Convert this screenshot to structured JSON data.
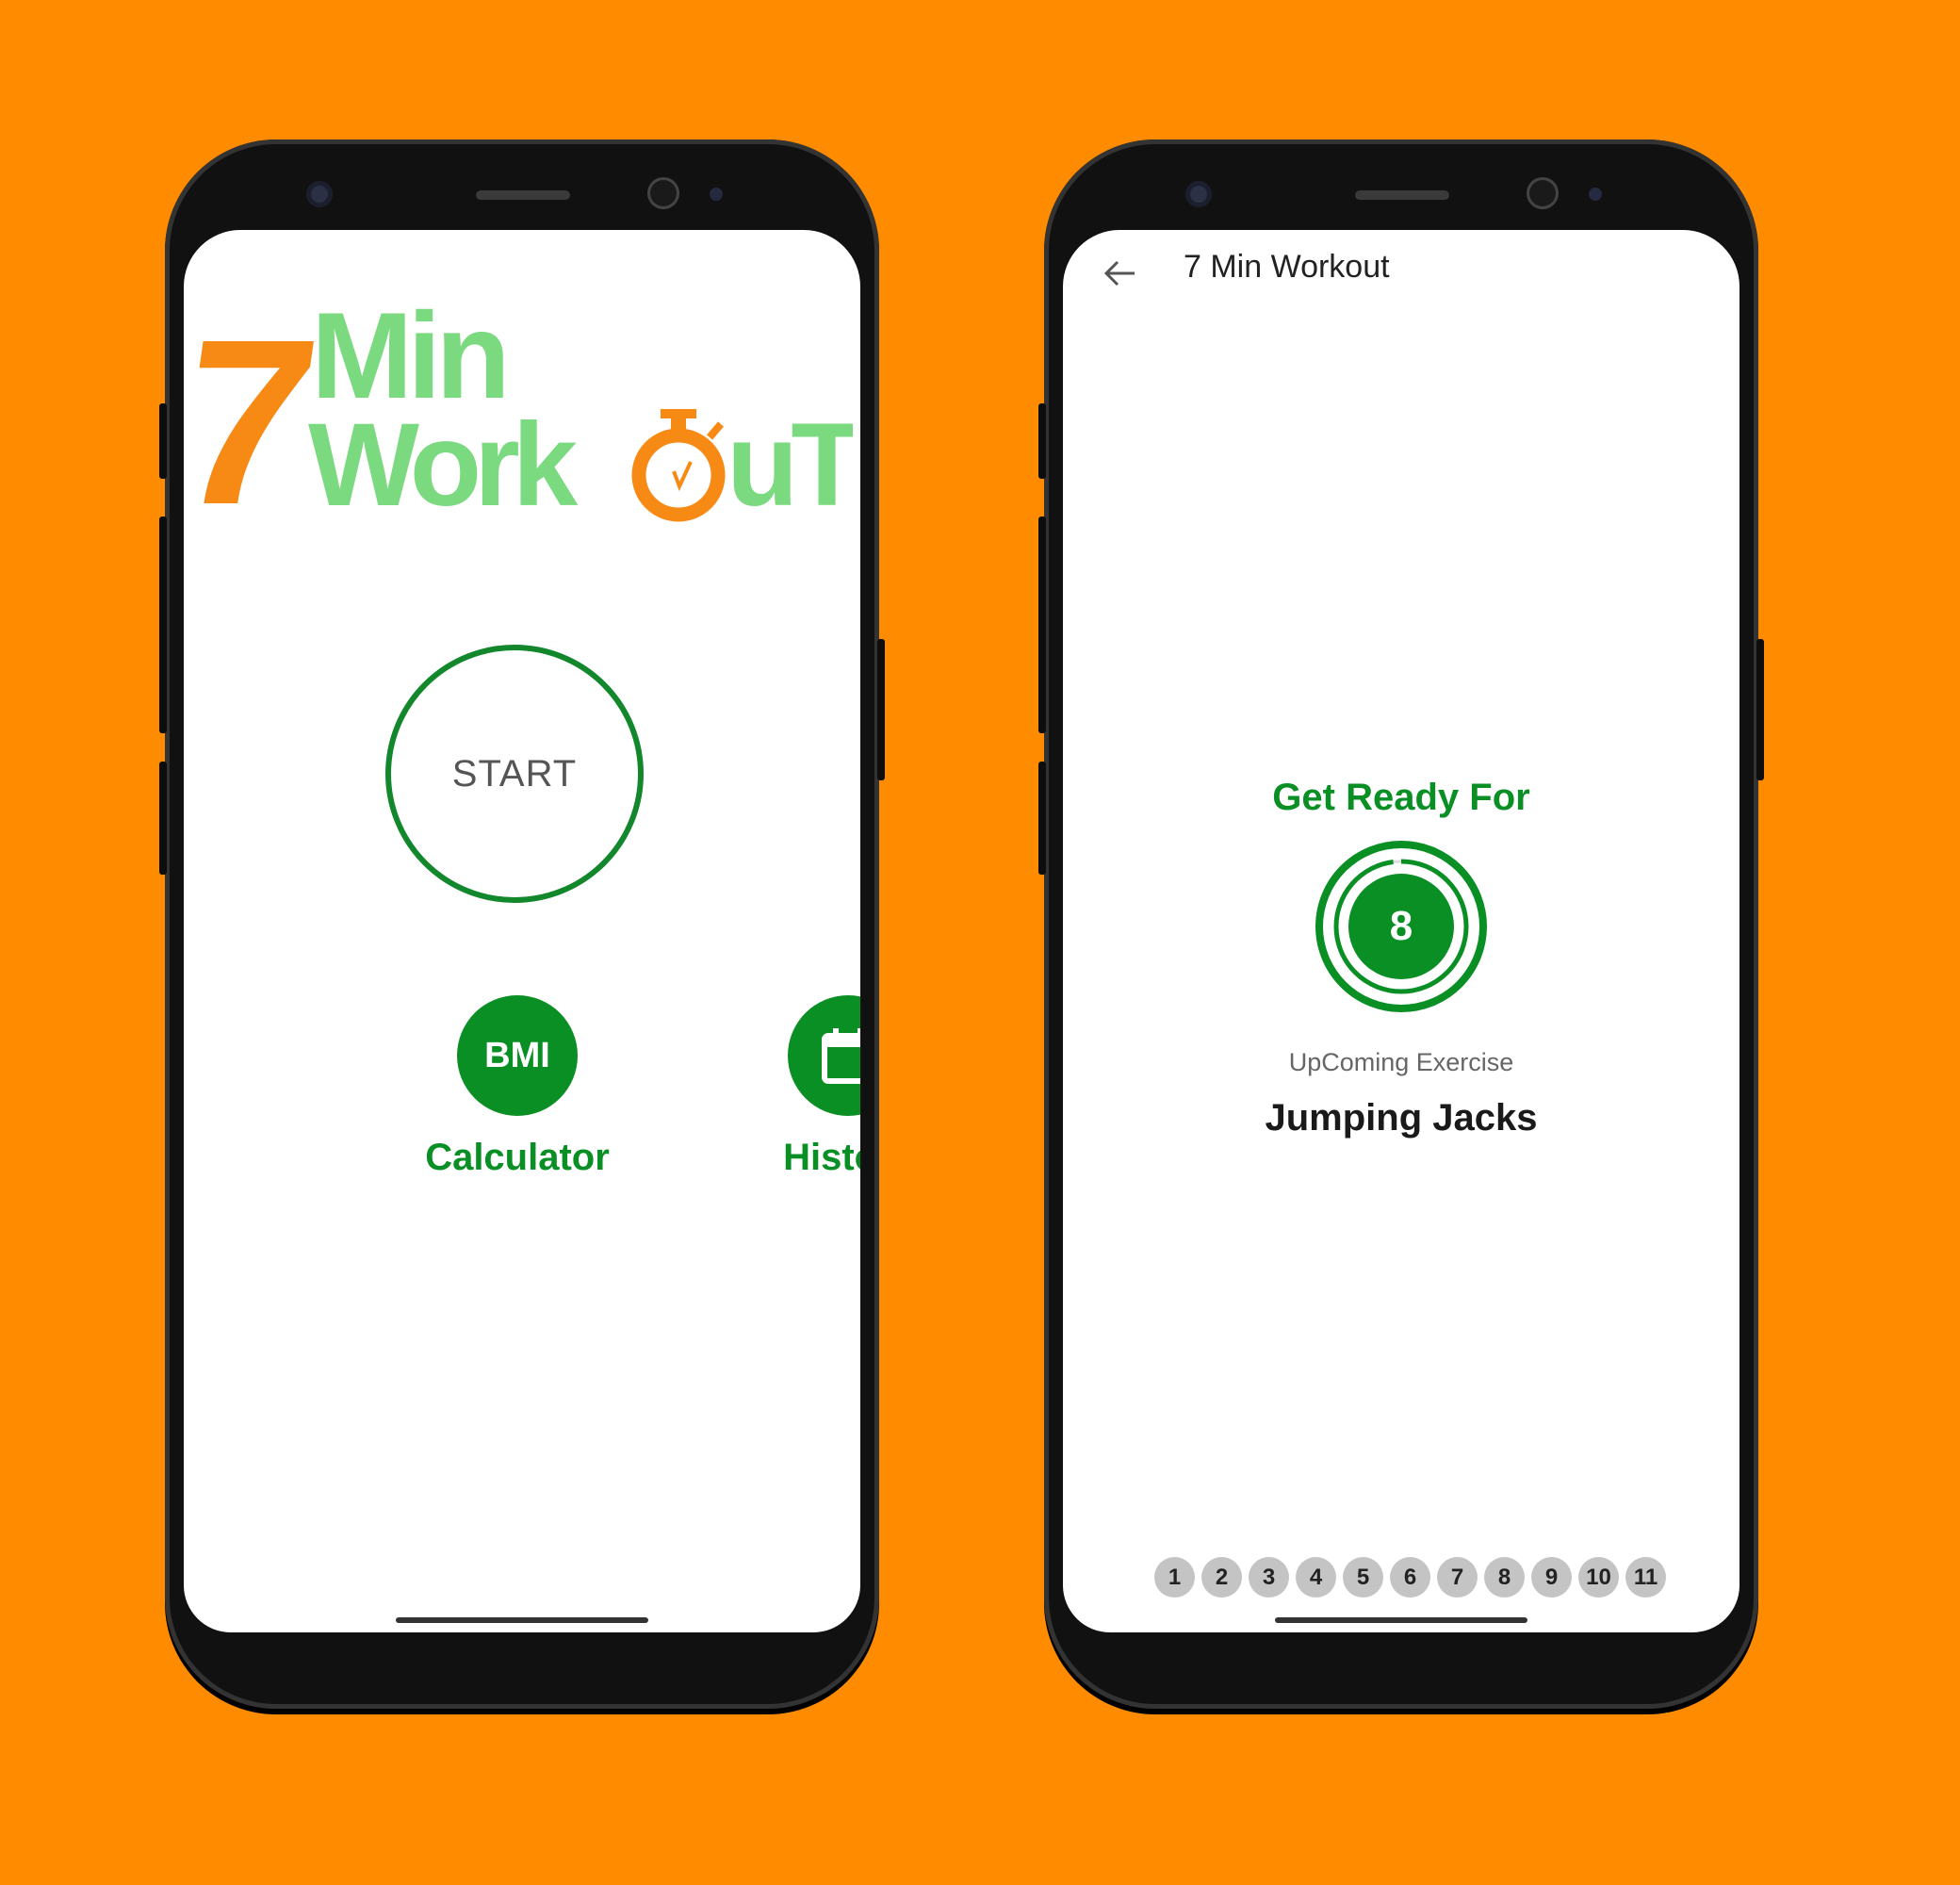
{
  "background_color": "#ff8c00",
  "accent_color": "#0a8f25",
  "home_screen": {
    "logo": {
      "digit": "7",
      "line1": "Min",
      "line2_prefix": "Work",
      "line2_o": "o",
      "line2_suffix": "uT",
      "colors": {
        "orange": "#f78a14",
        "green": "#7bd97f"
      }
    },
    "start_button": "START",
    "bmi_button": {
      "icon_text": "BMI",
      "label": "Calculator"
    },
    "history_button": {
      "icon": "calendar-icon",
      "label": "History"
    }
  },
  "exercise_screen": {
    "toolbar": {
      "back_icon": "arrow-back-icon",
      "title": "7 Min Workout"
    },
    "ready_title": "Get Ready For",
    "timer": {
      "value": "8",
      "progress": 0.98
    },
    "upcoming_label": "UpComing Exercise",
    "exercise_name": "Jumping Jacks",
    "steps": [
      "1",
      "2",
      "3",
      "4",
      "5",
      "6",
      "7",
      "8",
      "9",
      "10",
      "11"
    ]
  }
}
